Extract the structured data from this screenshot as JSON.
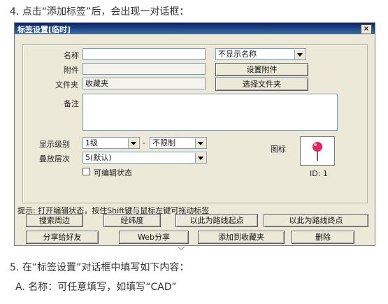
{
  "doc": {
    "step4": "4.  点击“添加标签”后，会出现一对话框：",
    "step5": "5.  在“标签设置”对话框中填写如下内容：",
    "stepA": "A.  名称：可任意填写，如填写“CAD”"
  },
  "dialog": {
    "title": "标签设置[临时]",
    "close": "×",
    "name_label": "名称",
    "name_value": "",
    "name_display_select": "不显示名称",
    "attach_label": "附件",
    "attach_value": "",
    "attach_button": "设置附件",
    "folder_label": "文件夹",
    "folder_value": "收藏夹",
    "folder_button": "选择文件夹",
    "note_label": "备注",
    "note_value": "",
    "level_label": "显示级别",
    "level_min": "1级",
    "level_sep": "-",
    "level_max": "不限制",
    "layer_label": "叠放层次",
    "layer_value": "5(默认)",
    "editable_label": "可编辑状态",
    "editable_checked": false,
    "icon_label": "图标",
    "id_label": "ID: 1",
    "hint": "提示: 打开编辑状态，按住Shift键与鼠标左键可拖动标签",
    "buttons_row1": [
      "搜索周边",
      "经纬度",
      "以此为路线起点",
      "以此为路线终点"
    ],
    "buttons_row2": [
      "分享给好友",
      "Web分享",
      "添加到收藏夹",
      "删除"
    ]
  }
}
